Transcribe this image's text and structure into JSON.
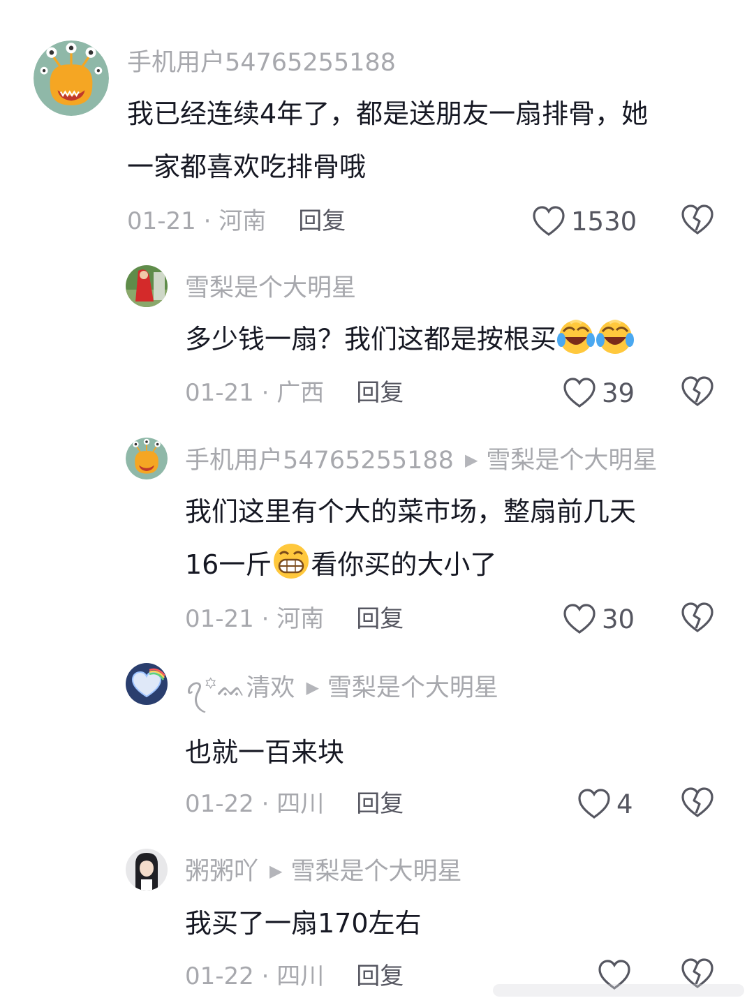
{
  "comments": [
    {
      "username": "手机用户54765255188",
      "reply_to": "",
      "lines": [
        "我已经连续4年了，都是送朋友一扇排骨，她",
        "一家都喜欢吃排骨哦"
      ],
      "date_location": "01-21 · 河南",
      "reply_label": "回复",
      "likes": "1530",
      "avatar_icon": "orange-monster-avatar"
    },
    {
      "username": "雪梨是个大明星",
      "reply_to": "",
      "lines": [
        "多少钱一扇？我们这都是按根买"
      ],
      "emojis": [
        "laugh-cry-emoji",
        "laugh-cry-emoji"
      ],
      "date_location": "01-21 · 广西",
      "reply_label": "回复",
      "likes": "39",
      "avatar_icon": "red-dress-photo-avatar"
    },
    {
      "username": "手机用户54765255188",
      "reply_to": "雪梨是个大明星",
      "lines": [
        "我们这里有个大的菜市场，整扇前几天",
        "16一斤",
        "看你买的大小了"
      ],
      "emojis": [
        "grin-emoji"
      ],
      "date_location": "01-21 · 河南",
      "reply_label": "回复",
      "likes": "30",
      "avatar_icon": "orange-monster-avatar"
    },
    {
      "username": "ꪖ꙳ᨐ清欢",
      "reply_to": "雪梨是个大明星",
      "lines": [
        "也就一百来块"
      ],
      "date_location": "01-22 · 四川",
      "reply_label": "回复",
      "likes": "4",
      "avatar_icon": "rainbow-heart-avatar"
    },
    {
      "username": "粥粥吖",
      "reply_to": "雪梨是个大明星",
      "lines": [
        "我买了一扇170左右"
      ],
      "date_location": "01-22 · 四川",
      "reply_label": "回复",
      "likes": "",
      "avatar_icon": "anime-character-avatar"
    }
  ],
  "colors": {
    "text": "#161823",
    "muted": "#a7a8ad",
    "icon": "#555660",
    "background": "#ffffff"
  }
}
